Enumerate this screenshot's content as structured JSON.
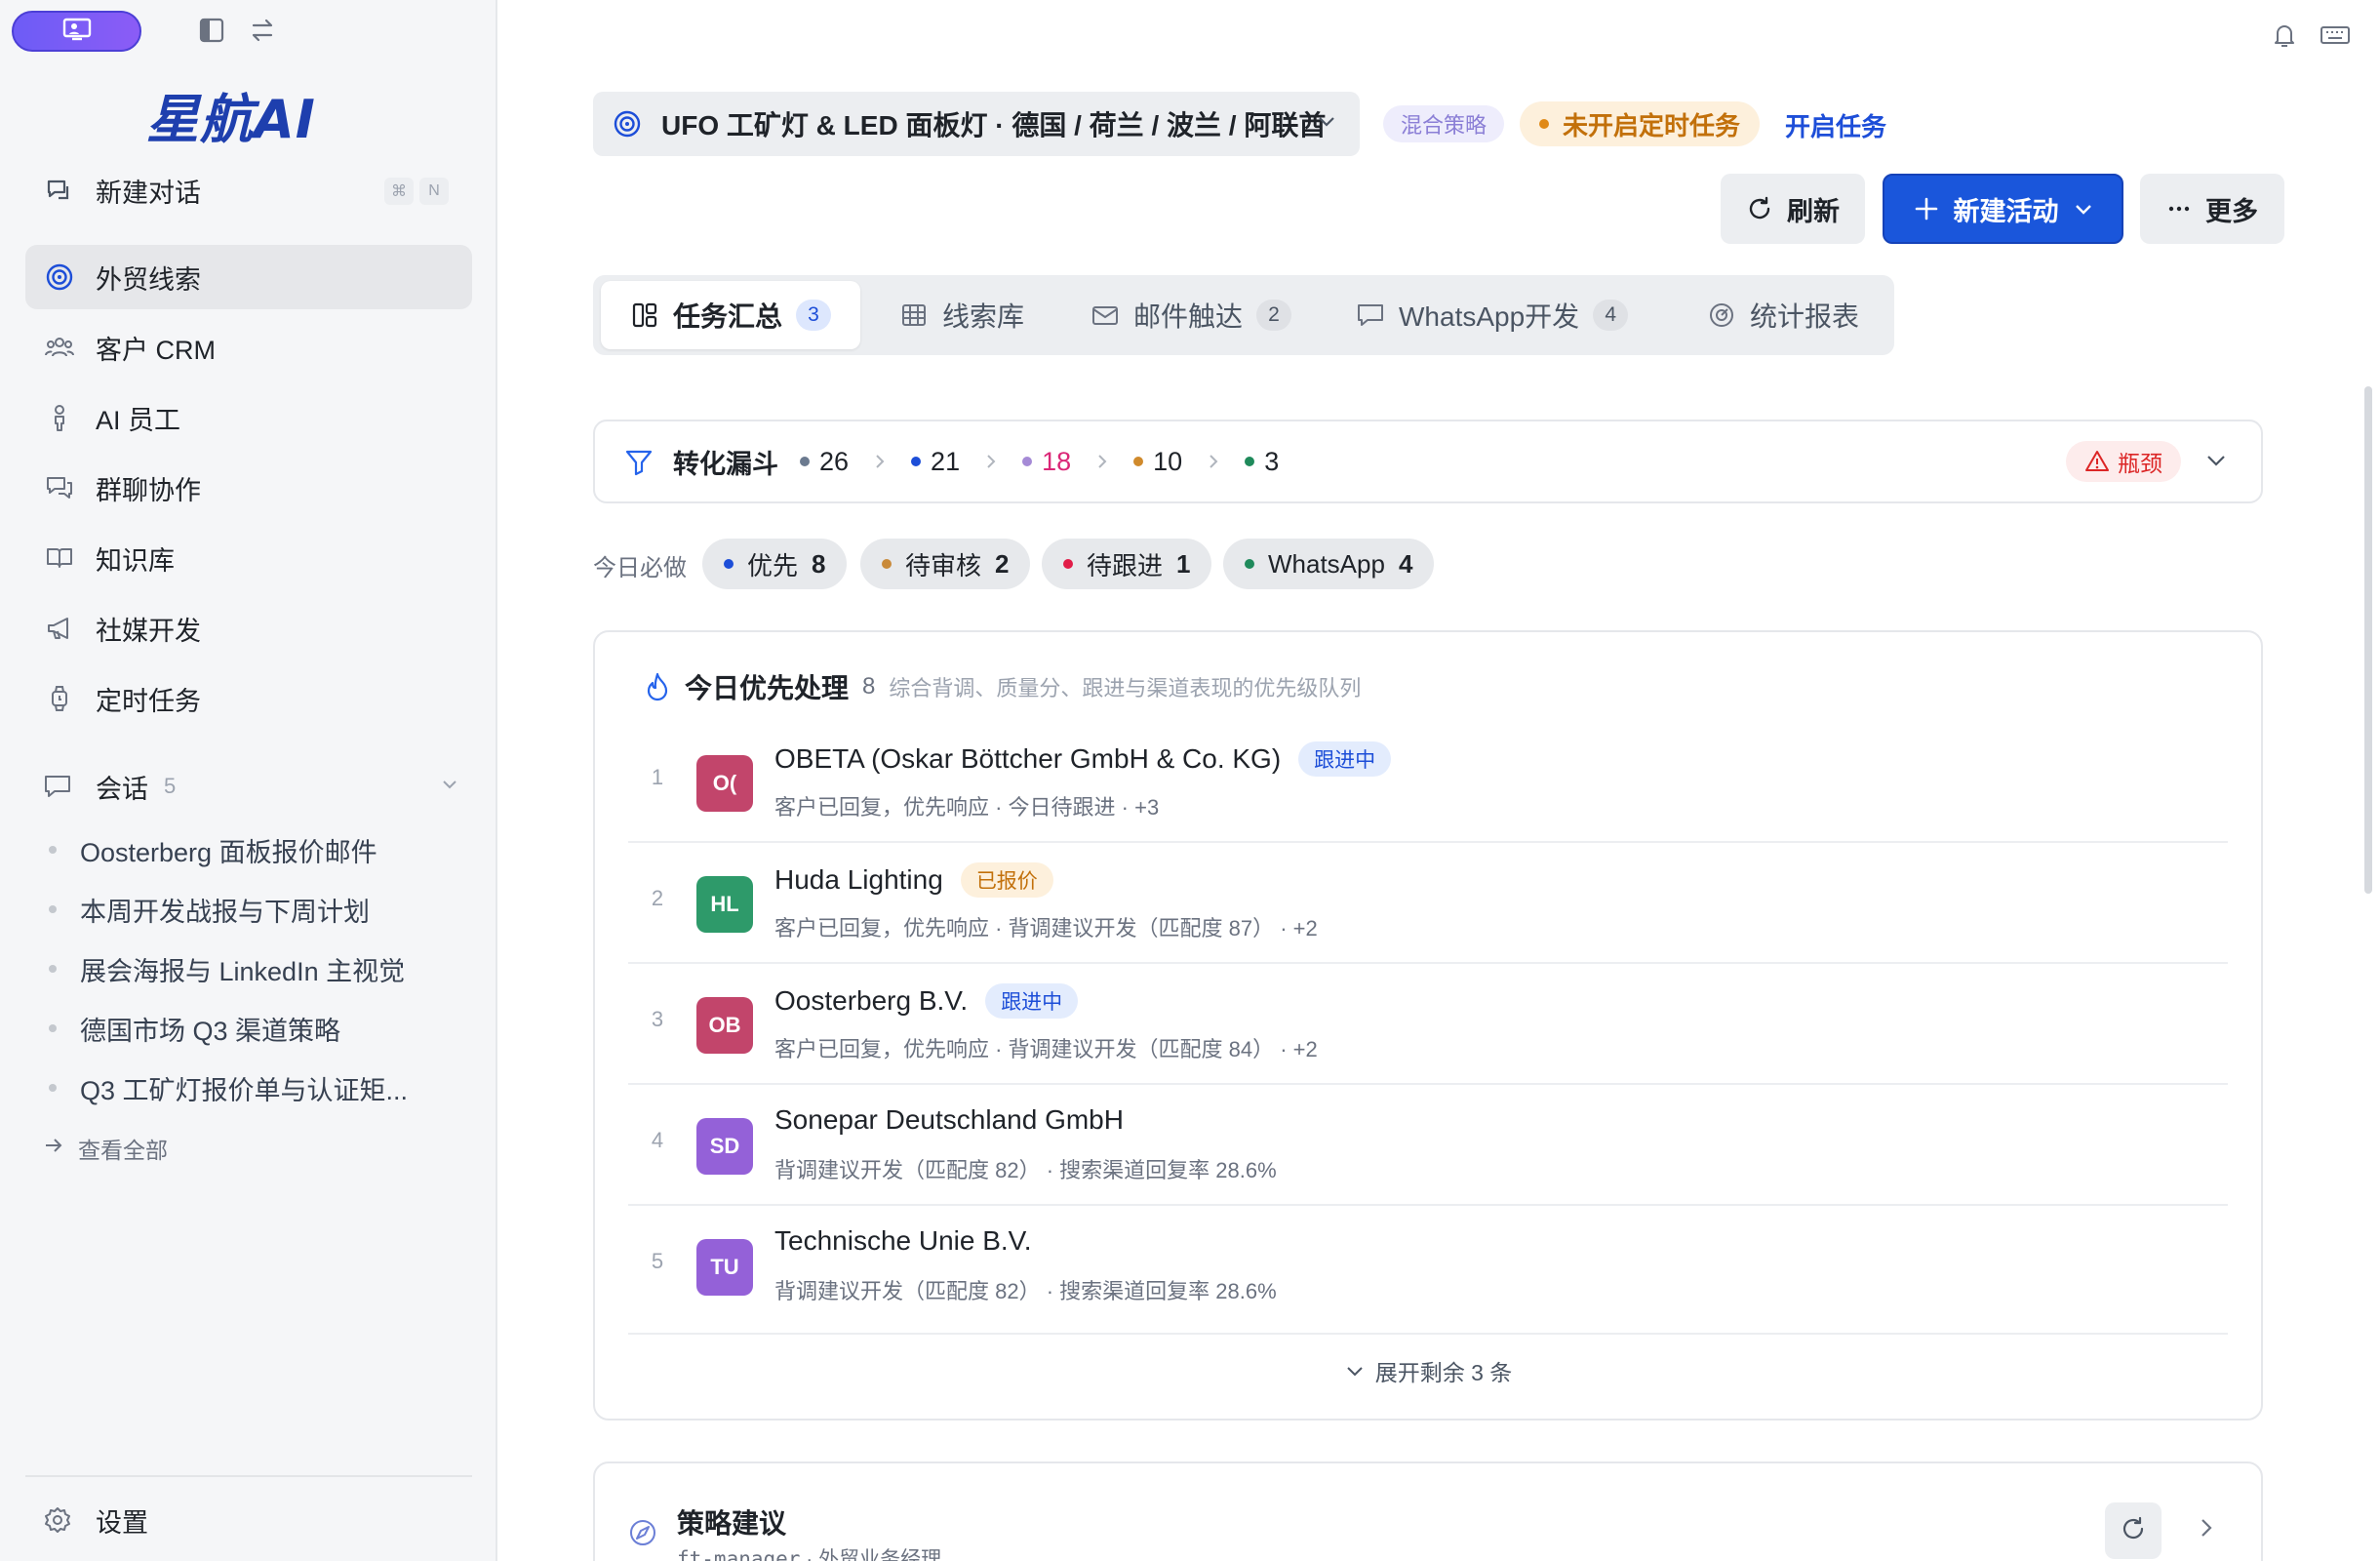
{
  "sidebar": {
    "logo": "星航AI",
    "new_chat": {
      "label": "新建对话",
      "keys": [
        "⌘",
        "N"
      ]
    },
    "nav": [
      {
        "label": "外贸线索",
        "icon": "target-icon",
        "active": true
      },
      {
        "label": "客户 CRM",
        "icon": "users-icon"
      },
      {
        "label": "AI 员工",
        "icon": "person-icon"
      },
      {
        "label": "群聊协作",
        "icon": "chat-icon"
      },
      {
        "label": "知识库",
        "icon": "book-icon"
      },
      {
        "label": "社媒开发",
        "icon": "megaphone-icon"
      },
      {
        "label": "定时任务",
        "icon": "watch-icon"
      }
    ],
    "sessions": {
      "label": "会话",
      "count": "5",
      "items": [
        "Oosterberg 面板报价邮件",
        "本周开发战报与下周计划",
        "展会海报与 LinkedIn 主视觉",
        "德国市场 Q3 渠道策略",
        "Q3 工矿灯报价单与认证矩..."
      ],
      "view_all": "查看全部"
    },
    "settings": "设置"
  },
  "header": {
    "campaign": "UFO 工矿灯 & LED 面板灯 · 德国 / 荷兰 / 波兰 / 阿联酋",
    "strategy_badge": "混合策略",
    "schedule_badge": "未开启定时任务",
    "start_link": "开启任务",
    "buttons": {
      "refresh": "刷新",
      "new_activity": "新建活动",
      "more": "更多"
    }
  },
  "tabs": [
    {
      "label": "任务汇总",
      "count": "3",
      "active": true
    },
    {
      "label": "线索库",
      "count": ""
    },
    {
      "label": "邮件触达",
      "count": "2"
    },
    {
      "label": "WhatsApp开发",
      "count": "4"
    },
    {
      "label": "统计报表",
      "count": ""
    }
  ],
  "funnel": {
    "title": "转化漏斗",
    "steps": [
      {
        "value": "26",
        "color": "#6b7a8f",
        "text_color": "#1f2329"
      },
      {
        "value": "21",
        "color": "#1d4ed8",
        "text_color": "#1f2329"
      },
      {
        "value": "18",
        "color": "#a58ad6",
        "text_color": "#db2777"
      },
      {
        "value": "10",
        "color": "#d08a2c",
        "text_color": "#1f2329"
      },
      {
        "value": "3",
        "color": "#1f8a5b",
        "text_color": "#1f2329"
      }
    ],
    "bottleneck": "瓶颈"
  },
  "today": {
    "label": "今日必做",
    "chips": [
      {
        "label": "优先",
        "count": "8",
        "color": "#1d4ed8"
      },
      {
        "label": "待审核",
        "count": "2",
        "color": "#c98a3a"
      },
      {
        "label": "待跟进",
        "count": "1",
        "color": "#e11d48"
      },
      {
        "label": "WhatsApp",
        "count": "4",
        "color": "#1f8a5b"
      }
    ]
  },
  "priority": {
    "title": "今日优先处理",
    "count": "8",
    "subtitle": "综合背调、质量分、跟进与渠道表现的优先级队列",
    "rows": [
      {
        "num": "1",
        "initials": "O(",
        "color": "#c2456b",
        "name": "OBETA (Oskar Böttcher GmbH & Co. KG)",
        "status": "跟进中",
        "status_kind": "blue",
        "desc": "客户已回复，优先响应 · 今日待跟进 · +3"
      },
      {
        "num": "2",
        "initials": "HL",
        "color": "#2e9a6a",
        "name": "Huda Lighting",
        "status": "已报价",
        "status_kind": "amber",
        "desc": "客户已回复，优先响应 · 背调建议开发（匹配度 87） · +2"
      },
      {
        "num": "3",
        "initials": "OB",
        "color": "#c2456b",
        "name": "Oosterberg B.V.",
        "status": "跟进中",
        "status_kind": "blue",
        "desc": "客户已回复，优先响应 · 背调建议开发（匹配度 84） · +2"
      },
      {
        "num": "4",
        "initials": "SD",
        "color": "#9461d8",
        "name": "Sonepar Deutschland GmbH",
        "status": "",
        "status_kind": "",
        "desc": "背调建议开发（匹配度 82） · 搜索渠道回复率 28.6%"
      },
      {
        "num": "5",
        "initials": "TU",
        "color": "#9461d8",
        "name": "Technische Unie B.V.",
        "status": "",
        "status_kind": "",
        "desc": "背调建议开发（匹配度 82） · 搜索渠道回复率 28.6%"
      }
    ],
    "expand": "展开剩余 3 条"
  },
  "strategy": {
    "title": "策略建议",
    "sub_id": "ft-manager",
    "sub_role": "外贸业务经理"
  }
}
